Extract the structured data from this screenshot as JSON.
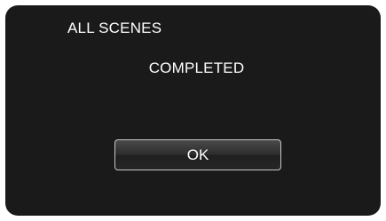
{
  "dialog": {
    "title": "ALL SCENES",
    "message": "COMPLETED",
    "ok_label": "OK"
  },
  "colors": {
    "screen_background": "#1a1a1a",
    "text": "#ffffff",
    "button_border": "#c8c8c8"
  }
}
